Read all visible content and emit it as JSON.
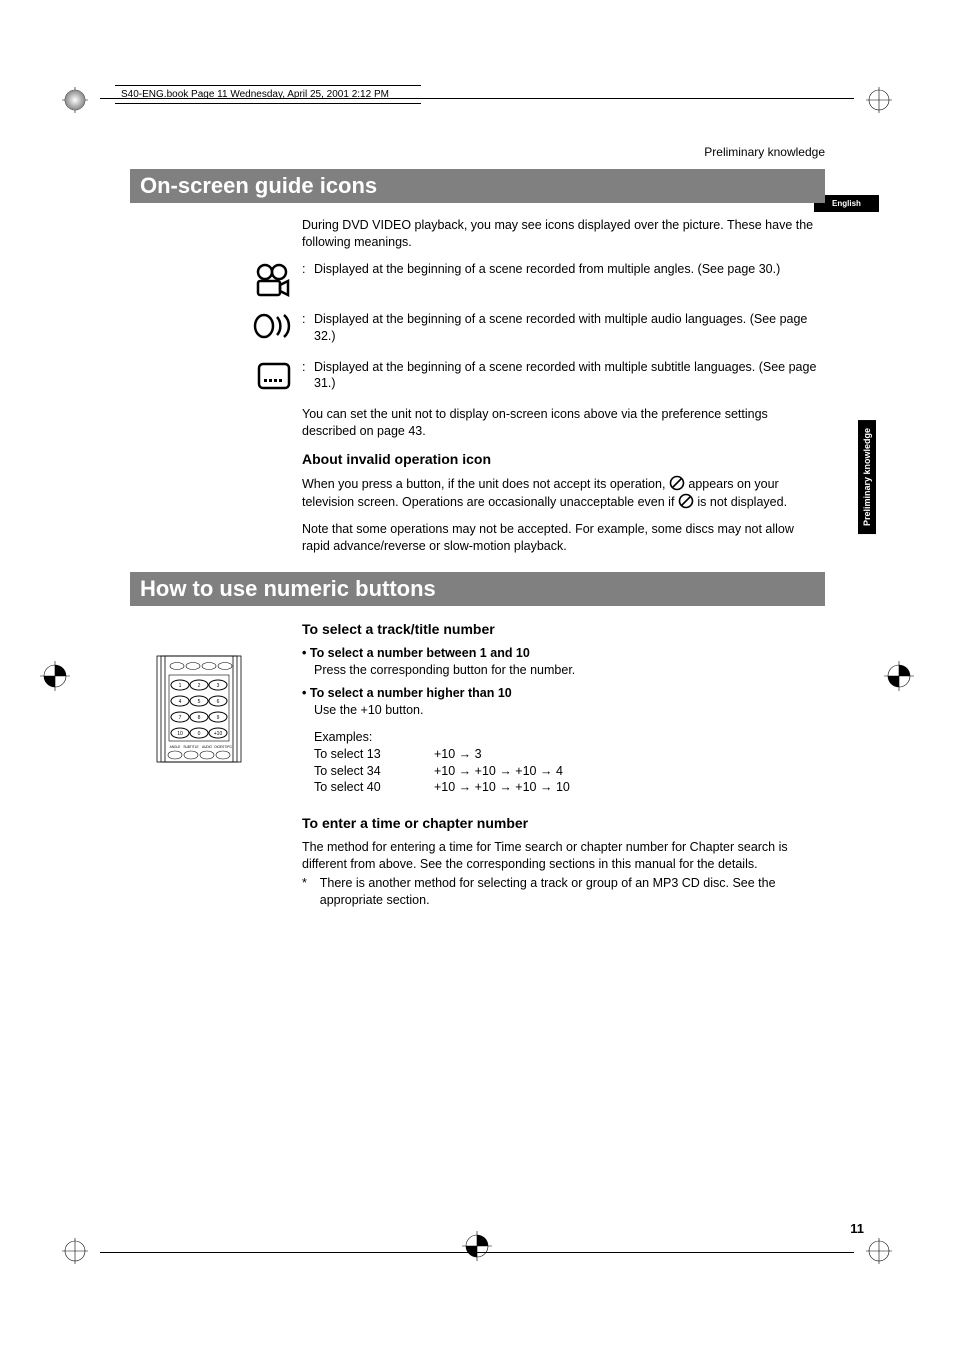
{
  "header": {
    "book_info": "S40-ENG.book  Page 11  Wednesday, April 25, 2001  2:12 PM",
    "running_head": "Preliminary knowledge",
    "english_tab": "English",
    "side_tab": "Preliminary\nknowledge"
  },
  "section1": {
    "title": "On-screen guide icons",
    "intro": "During DVD VIDEO playback, you may see icons displayed over the picture.  These have the following meanings.",
    "rows": [
      "Displayed at the beginning of a scene recorded from multiple angles. (See page 30.)",
      "Displayed at the beginning of a scene recorded with multiple audio languages. (See page 32.)",
      "Displayed at the beginning of a scene recorded with multiple subtitle languages.  (See page 31.)"
    ],
    "pref_note": "You can set the unit not to display on-screen icons above via the preference settings described on page 43.",
    "sub_head": "About invalid operation icon",
    "invalid1_a": "When you press a button, if the unit does not accept its operation, ",
    "invalid1_b": " appears on your television screen. Operations are occasionally unacceptable even if ",
    "invalid1_c": " is not displayed.",
    "invalid2": "Note that some operations may not be accepted. For example, some discs may not allow rapid advance/reverse or slow-motion playback."
  },
  "section2": {
    "title": "How to use numeric buttons",
    "sub1": "To select a track/title number",
    "b1_head": "To select a number between 1 and 10",
    "b1_body": "Press the corresponding button for the number.",
    "b2_head": "To select a number higher than 10",
    "b2_body": "Use the +10 button.",
    "examples_label": "Examples:",
    "examples": [
      {
        "label": "To select 13",
        "steps": "+10 → 3"
      },
      {
        "label": "To select 34",
        "steps": "+10 → +10 → +10 → 4"
      },
      {
        "label": "To select 40",
        "steps": "+10 → +10 → +10 → 10"
      }
    ],
    "sub2": "To enter a time or chapter number",
    "p2": "The method for entering a time for Time search or chapter number for Chapter search is different from above. See the corresponding sections in this manual for the details.",
    "star": "There is another method for selecting a track or group of an MP3 CD disc. See the appropriate section."
  },
  "page_number": "11"
}
